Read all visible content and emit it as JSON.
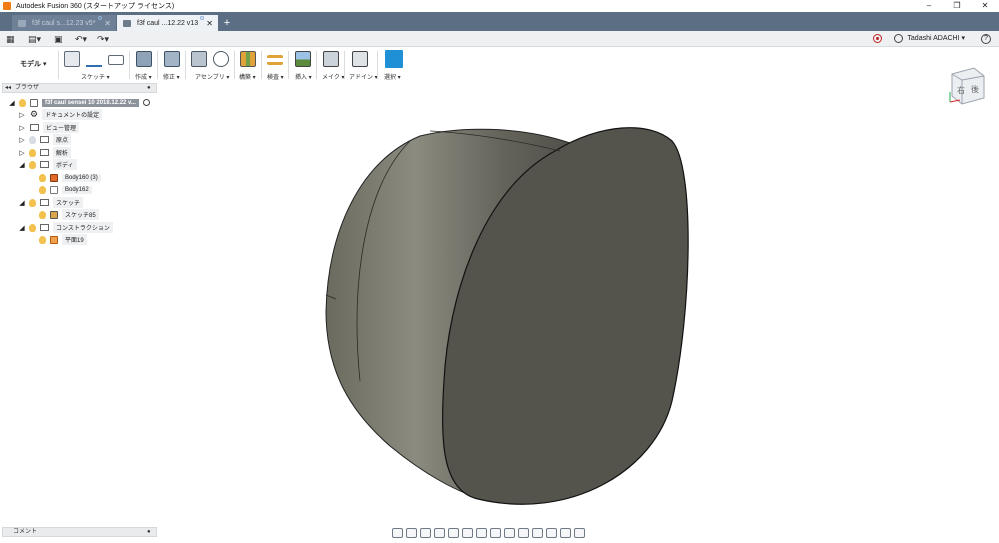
{
  "window": {
    "title": "Autodesk Fusion 360 (スタートアップ ライセンス)",
    "controls": [
      "–",
      "❐",
      "✕"
    ]
  },
  "tabs": [
    {
      "label": "f3f caul s...12.23 v5*",
      "state": "inactive"
    },
    {
      "label": "f3f caul ...12.22 v13",
      "state": "active"
    }
  ],
  "tab_add": "+",
  "quick_access": {
    "user": "Tadashi ADACHI ▾",
    "help": "?"
  },
  "ribbon": {
    "workspace": "モデル ▾",
    "groups": [
      {
        "label": "スケッチ ▾"
      },
      {
        "label": "作成 ▾"
      },
      {
        "label": "修正 ▾"
      },
      {
        "label": "アセンブリ ▾"
      },
      {
        "label": "構築 ▾"
      },
      {
        "label": "検査 ▾"
      },
      {
        "label": "挿入 ▾"
      },
      {
        "label": "メイク ▾"
      },
      {
        "label": "アドイン ▾"
      },
      {
        "label": "選択 ▾"
      }
    ]
  },
  "browser": {
    "title": "ブラウザ",
    "collapse": "◂◂",
    "root": "f3f caul sensei 10 2018.12.22 v...",
    "items": [
      {
        "label": "ドキュメントの設定"
      },
      {
        "label": "ビュー管理"
      },
      {
        "label": "原点"
      },
      {
        "label": "解析"
      },
      {
        "label": "ボディ"
      },
      {
        "label": "Body160 (3)"
      },
      {
        "label": "Body162"
      },
      {
        "label": "スケッチ"
      },
      {
        "label": "スケッチ85"
      },
      {
        "label": "コンストラクション"
      },
      {
        "label": "平面19"
      }
    ]
  },
  "comment_panel": {
    "title": "コメント"
  },
  "viewcube": {
    "front": "右",
    "side": "後"
  }
}
